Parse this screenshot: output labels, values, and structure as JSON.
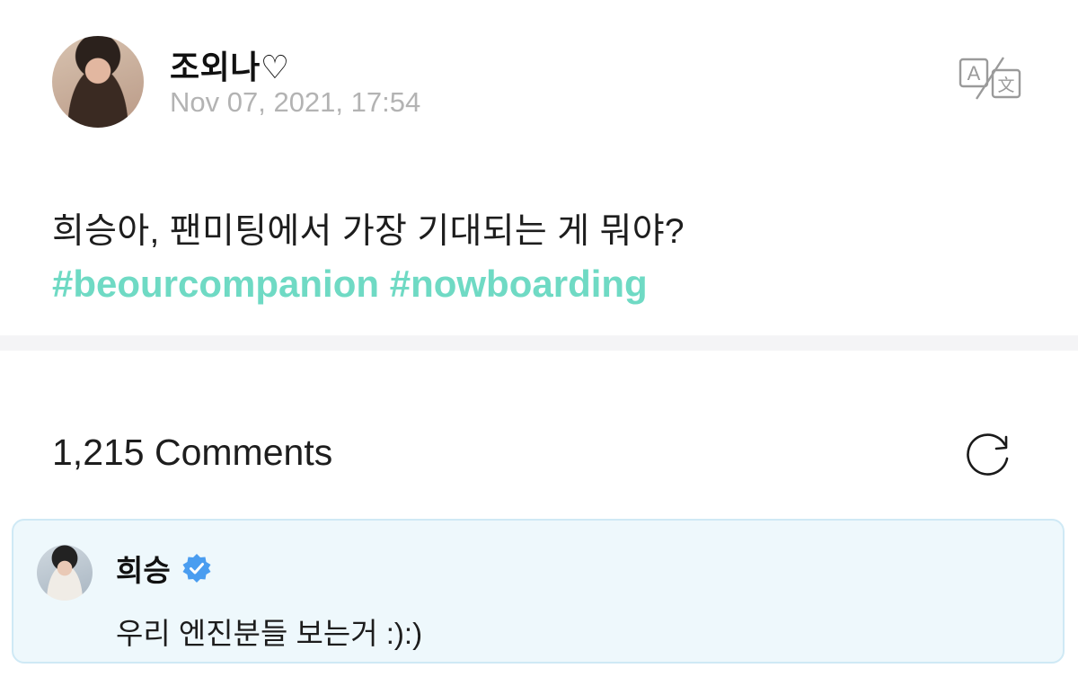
{
  "post": {
    "author": "조외나♡",
    "timestamp": "Nov 07, 2021, 17:54",
    "text": "희승아, 팬미팅에서 가장 기대되는 게 뭐야?",
    "hashtags": [
      "#beourcompanion",
      "#nowboarding"
    ]
  },
  "comments": {
    "count_label": "1,215 Comments",
    "items": [
      {
        "author": "희승",
        "verified": true,
        "text": "우리 엔진분들 보는거 :):)"
      }
    ]
  },
  "icons": {
    "translate": "translate-icon",
    "refresh": "refresh-icon",
    "verified": "verified-badge-icon"
  },
  "colors": {
    "hashtag": "#6fdac4",
    "timestamp": "#b3b3b3",
    "comment_bg": "#eef8fc",
    "comment_border": "#cfe9f5",
    "verified": "#4a9df0"
  }
}
